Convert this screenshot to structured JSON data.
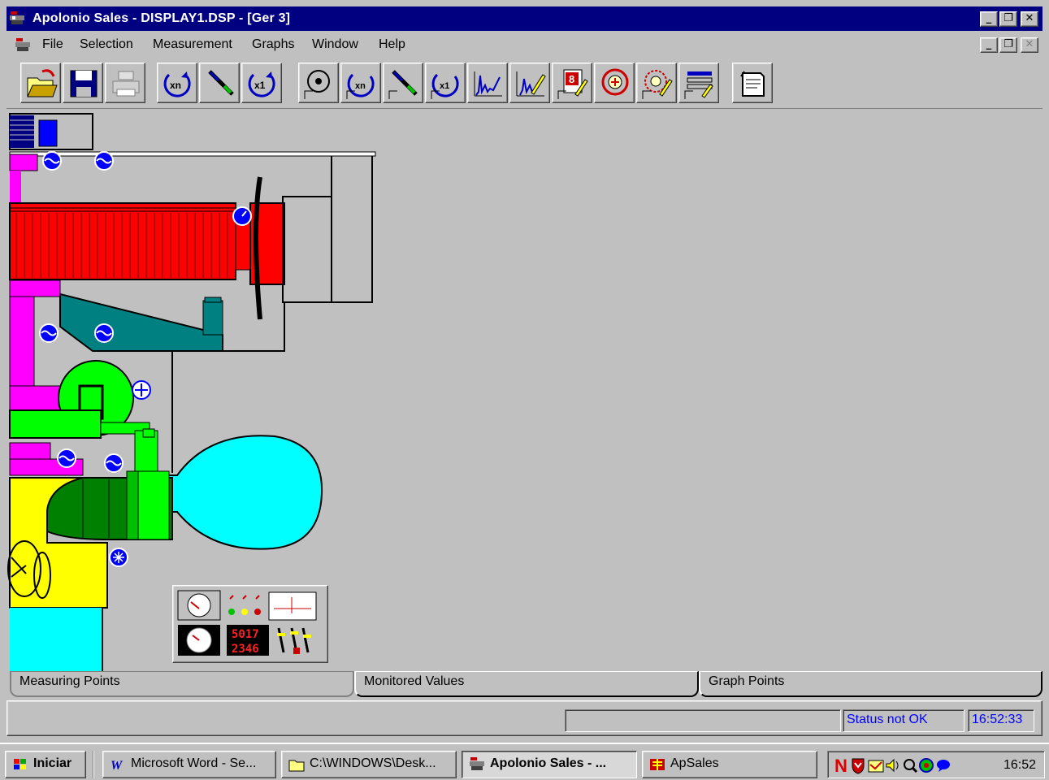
{
  "window": {
    "title": "Apolonio Sales - DISPLAY1.DSP - [Ger 3]",
    "minimize": "_",
    "restore": "❐",
    "close": "✕"
  },
  "menu": {
    "items": [
      {
        "label": "File",
        "accel": "F"
      },
      {
        "label": "Selection",
        "accel": "S"
      },
      {
        "label": "Measurement",
        "accel": "M"
      },
      {
        "label": "Graphs",
        "accel": "G"
      },
      {
        "label": "Window",
        "accel": "W"
      },
      {
        "label": "Help",
        "accel": "H"
      }
    ]
  },
  "toolbar": {
    "buttons": [
      {
        "icon": "open-folder-icon"
      },
      {
        "icon": "save-disk-icon"
      },
      {
        "icon": "print-icon"
      },
      {
        "icon": "zoom-xn-icon",
        "text": "xn"
      },
      {
        "icon": "probe-icon"
      },
      {
        "icon": "zoom-x1-icon",
        "text": "x1"
      },
      {
        "icon": "measure-disk-icon"
      },
      {
        "icon": "measure-xn-icon",
        "text": "xn"
      },
      {
        "icon": "measure-probe-icon"
      },
      {
        "icon": "measure-x1-icon",
        "text": "x1"
      },
      {
        "icon": "spectrum-icon"
      },
      {
        "icon": "spectrum-edit-icon"
      },
      {
        "icon": "value-8-icon",
        "text": "8"
      },
      {
        "icon": "target-icon"
      },
      {
        "icon": "target-edit-icon"
      },
      {
        "icon": "list-edit-icon"
      },
      {
        "icon": "notes-icon"
      }
    ]
  },
  "diagram": {
    "legend_digits_top": "5017",
    "legend_digits_bottom": "2346",
    "colors": {
      "generator": "#ff0000",
      "bearing_housing": "#ff00ff",
      "oil_tank": "#008080",
      "gearbox": "#00ff00",
      "turbine": "#00ffff",
      "turbine_inlet": "#008000",
      "housing_yellow": "#ffff00",
      "sensor_icon": "#0000ff"
    }
  },
  "tabs": [
    {
      "label": "Measuring Points",
      "active": true
    },
    {
      "label": "Monitored Values",
      "active": false
    },
    {
      "label": "Graph Points",
      "active": false
    }
  ],
  "status": {
    "message": "",
    "state": "Status not OK",
    "time": "16:52:33"
  },
  "taskbar": {
    "start_label": "Iniciar",
    "tasks": [
      {
        "label": "Microsoft Word - Se...",
        "icon": "word-icon",
        "active": false
      },
      {
        "label": "C:\\WINDOWS\\Desk...",
        "icon": "folder-icon",
        "active": false
      },
      {
        "label": "Apolonio Sales - ...",
        "icon": "apolonio-app-icon",
        "active": true
      },
      {
        "label": "ApSales",
        "icon": "apsales-icon",
        "active": false
      }
    ],
    "clock": "16:52"
  }
}
